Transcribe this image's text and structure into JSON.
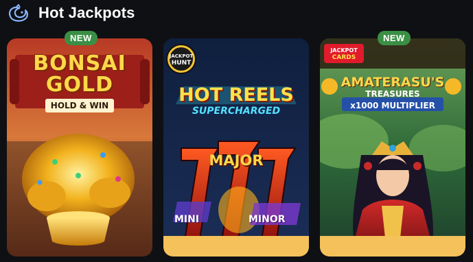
{
  "header": {
    "title": "Hot Jackpots",
    "icon": "dragon-icon"
  },
  "games": [
    {
      "badge": "NEW",
      "logo_line1": "BONSAI",
      "logo_line2": "GOLD",
      "tagline": "HOLD & WIN",
      "accent": "#f4c15a"
    },
    {
      "badge": "",
      "provider": [
        "JACKPOT",
        "HUNT"
      ],
      "logo_line1": "HOT REELS",
      "logo_line2": "SUPERCHARGED",
      "tiers": [
        "MAJOR",
        "MINI",
        "MINOR"
      ],
      "accent": "#f4c15a"
    },
    {
      "badge": "NEW",
      "provider": [
        "JACKPOT",
        "CARDS"
      ],
      "logo_line1": "AMATERASU'S",
      "logo_line2": "TREASURES",
      "tagline": "x1000 MULTIPLIER",
      "accent": "#f4c15a"
    }
  ],
  "colors": {
    "background": "#0f1013",
    "badge": "#3a8f45",
    "footer": "#f4c15a"
  }
}
